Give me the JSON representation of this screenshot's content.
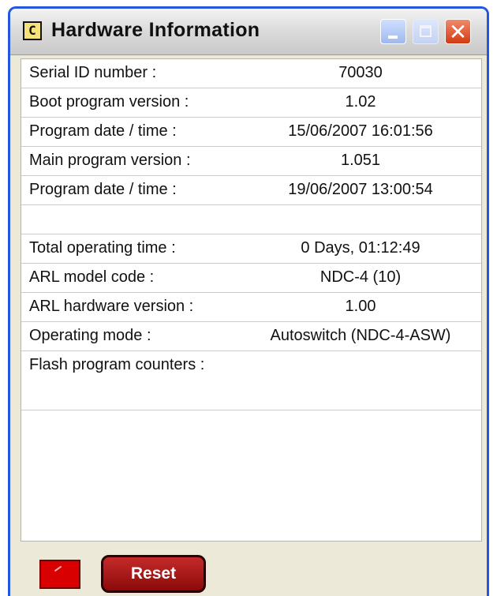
{
  "window": {
    "title": "Hardware Information",
    "icon_glyph": "C",
    "controls": [
      "minimize",
      "maximize",
      "close"
    ]
  },
  "info_rows": [
    {
      "label": "Serial ID number :",
      "value": "70030"
    },
    {
      "label": "Boot program version :",
      "value": "1.02"
    },
    {
      "label": "Program date / time :",
      "value": "15/06/2007   16:01:56"
    },
    {
      "label": "Main program version :",
      "value": "1.051"
    },
    {
      "label": "Program date / time :",
      "value": "19/06/2007   13:00:54"
    },
    {
      "label": "",
      "value": ""
    },
    {
      "label": "Total operating time :",
      "value": "0 Days, 01:12:49"
    },
    {
      "label": "ARL model code :",
      "value": "NDC-4 (10)"
    },
    {
      "label": "ARL hardware version :",
      "value": "1.00"
    },
    {
      "label": "Operating mode :",
      "value": "Autoswitch (NDC-4-ASW)"
    },
    {
      "label": "Flash program counters :",
      "value": ""
    }
  ],
  "footer": {
    "reset_label": "Reset"
  },
  "colors": {
    "titlebar_border": "#2456e0",
    "reset_button": "#a51515",
    "indicator": "#d80000"
  },
  "icons": {
    "app": "app-icon",
    "minimize": "minimize-icon",
    "maximize": "maximize-icon",
    "close": "close-icon"
  }
}
